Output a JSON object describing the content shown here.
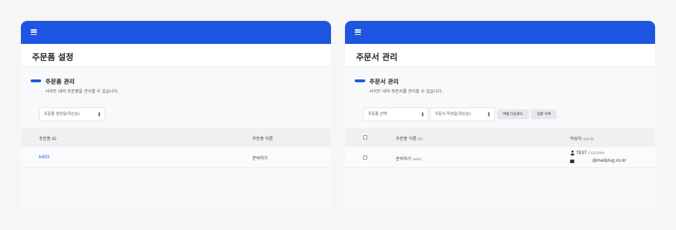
{
  "left": {
    "page_title": "주문폼 설정",
    "section_title": "주문폼 관리",
    "section_desc": "사이트 내의 주문폼을 관리할 수 있습니다.",
    "sort_select": "주문폼 생성일(최신순)",
    "columns": {
      "id": "주문폼 ID",
      "name": "주문폼 이름"
    },
    "rows": [
      {
        "id": "bd02",
        "name": "문의하기"
      }
    ]
  },
  "right": {
    "page_title": "주문서 관리",
    "section_title": "주문서 관리",
    "section_desc": "사이트 내의 주문서를 관리할 수 있습니다.",
    "form_select": "주문폼 선택",
    "sort_select": "주문서 작성일(최신순)",
    "excel_button": "엑셀 다운로드",
    "bulk_delete_button": "일괄 삭제",
    "columns": {
      "name": "주문폼 이름",
      "name_sub": "(ID)",
      "author": "작성자",
      "author_sub": "(회원 ID)"
    },
    "rows": [
      {
        "form_name": "문의하기",
        "form_id": "(bd02)",
        "author_name": "TEST",
        "author_member_id": "(15221049)",
        "email": "@mailplug.co.kr"
      }
    ]
  },
  "icons": {
    "menu": "hamburger-icon",
    "sort": "up-down-caret-icon",
    "user": "person-icon",
    "mail": "envelope-icon"
  },
  "colors": {
    "accent": "#1d56e0",
    "link": "#1d56e0"
  }
}
